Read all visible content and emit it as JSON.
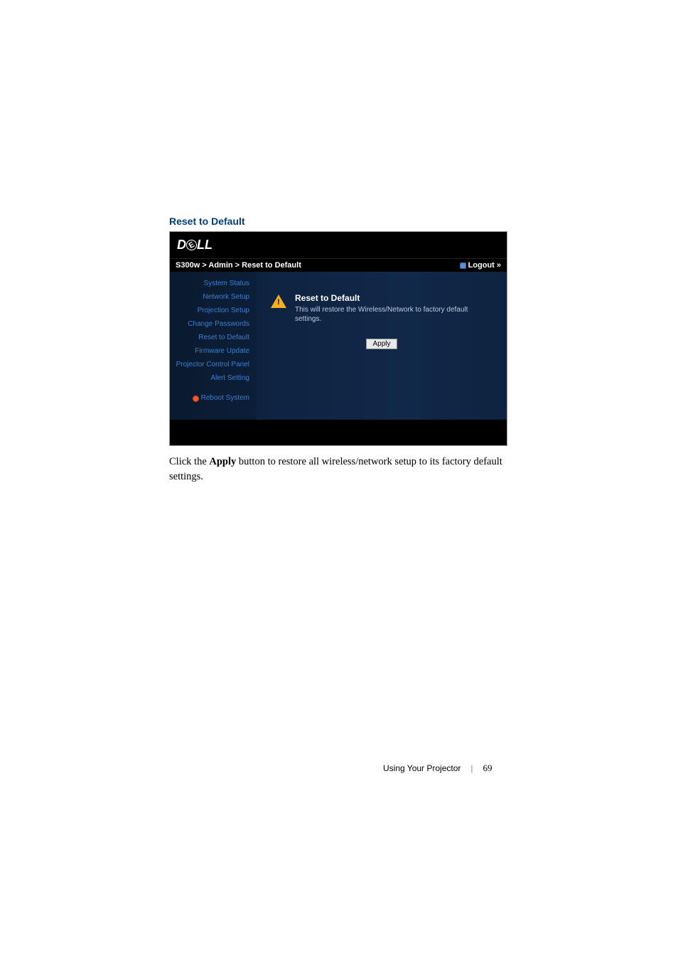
{
  "section": {
    "heading": "Reset to Default"
  },
  "screenshot": {
    "logo": {
      "d": "D",
      "e": "E",
      "ll": "LL"
    },
    "breadcrumb": "S300w > Admin > Reset to Default",
    "logout": "Logout »",
    "sidebar": {
      "items": [
        "System Status",
        "Network Setup",
        "Projection Setup",
        "Change Passwords",
        "Reset to Default",
        "Firmware Update",
        "Projector Control Panel",
        "Alert Setting"
      ],
      "reboot": "Reboot System"
    },
    "main": {
      "title": "Reset to Default",
      "desc": "This will restore the Wireless/Network to factory default settings.",
      "apply": "Apply"
    }
  },
  "below_text": {
    "prefix": "Click the ",
    "bold": "Apply",
    "suffix": " button to restore all wireless/network setup to its factory default settings."
  },
  "footer": {
    "label": "Using Your Projector",
    "page": "69"
  }
}
